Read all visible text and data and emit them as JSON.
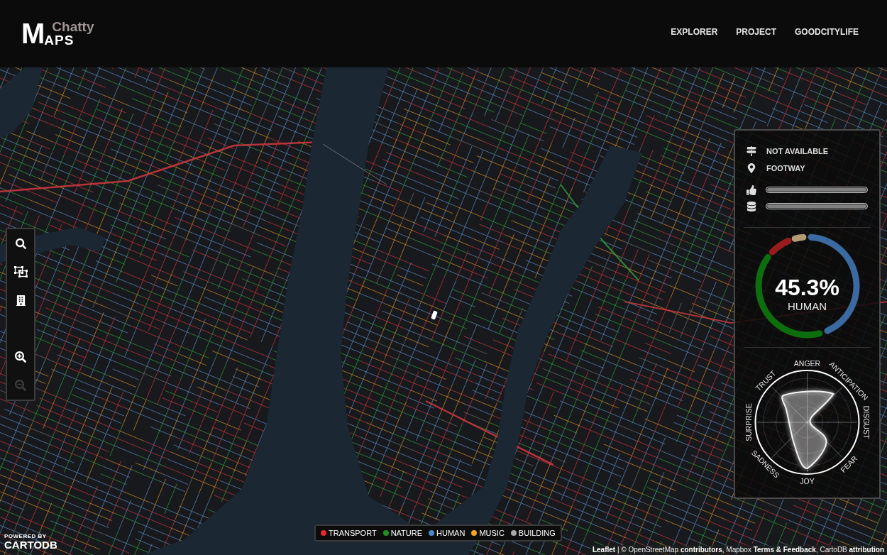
{
  "header": {
    "logo": {
      "initial": "M",
      "upper_word": "Chatty",
      "lower_word": "APS"
    },
    "nav": [
      {
        "label": "EXPLORER"
      },
      {
        "label": "PROJECT"
      },
      {
        "label": "GOODCITYLIFE"
      }
    ]
  },
  "toolbar": {
    "tools": [
      {
        "kind": "search",
        "disabled": false
      },
      {
        "kind": "select",
        "disabled": false
      },
      {
        "kind": "buildings",
        "disabled": false
      }
    ],
    "zoom": [
      {
        "kind": "zoom_in",
        "disabled": false
      },
      {
        "kind": "zoom_out",
        "disabled": true
      }
    ]
  },
  "info_panel": {
    "details": [
      {
        "kind": "street_name",
        "text": "NOT AVAILABLE"
      },
      {
        "kind": "street_type",
        "text": "FOOTWAY"
      }
    ],
    "meters": [
      {
        "kind": "likes",
        "level": 1
      },
      {
        "kind": "data",
        "level": 1
      }
    ],
    "sound_gauge": {
      "value": "45.3%",
      "label": "HUMAN"
    },
    "emotion_radar": {
      "axes": [
        "ANGER",
        "ANTICIPATION",
        "DISGUST",
        "FEAR",
        "JOY",
        "SADNESS",
        "SURPRISE",
        "TRUST"
      ]
    }
  },
  "legend": [
    {
      "label": "TRANSPORT",
      "color": "#e8262d"
    },
    {
      "label": "NATURE",
      "color": "#1f8f1f"
    },
    {
      "label": "HUMAN",
      "color": "#4a86c8"
    },
    {
      "label": "MUSIC",
      "color": "#f5a623"
    },
    {
      "label": "BUILDING",
      "color": "#aaaaaa"
    }
  ],
  "credits": {
    "powered_by": "POWERED BY",
    "brand": "CARTODB"
  },
  "attribution": [
    {
      "kind": "link",
      "text": "Leaflet"
    },
    {
      "kind": "text",
      "text": " | © OpenStreetMap "
    },
    {
      "kind": "link",
      "text": "contributors"
    },
    {
      "kind": "text",
      "text": ", Mapbox "
    },
    {
      "kind": "link",
      "text": "Terms & Feedback"
    },
    {
      "kind": "text",
      "text": ", CartoDB "
    },
    {
      "kind": "link",
      "text": "attribution"
    }
  ]
}
